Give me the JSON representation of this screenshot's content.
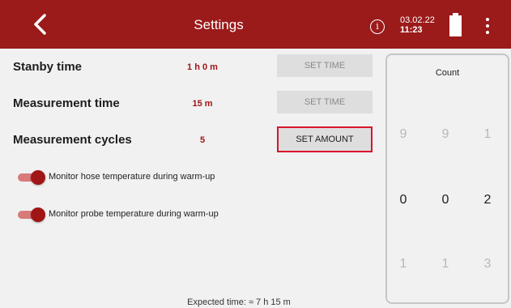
{
  "header": {
    "title": "Settings",
    "info_glyph": "i",
    "date": "03.02.22",
    "time": "11:23",
    "back_icon": "chevron-left-icon",
    "battery_icon": "battery-full-icon",
    "menu_icon": "more-vertical-icon",
    "color": "#9b1a1a"
  },
  "settings": {
    "rows": [
      {
        "label": "Stanby time",
        "value": "1 h 0 m",
        "button": "SET TIME",
        "active": false
      },
      {
        "label": "Measurement time",
        "value": "15 m",
        "button": "SET TIME",
        "active": false
      },
      {
        "label": "Measurement cycles",
        "value": "5",
        "button": "SET AMOUNT",
        "active": true
      }
    ],
    "toggles": [
      {
        "label": "Monitor hose temperature during warm-up",
        "on": true
      },
      {
        "label": "Monitor probe temperature during warm-up",
        "on": true
      }
    ],
    "expected_time": "Expected time: ≈ 7 h 15 m",
    "accent_color": "#a01515",
    "highlight_color": "#d8152b"
  },
  "count_panel": {
    "title": "Count",
    "columns": [
      {
        "above": "9",
        "current": "0",
        "below": "1"
      },
      {
        "above": "9",
        "current": "0",
        "below": "1"
      },
      {
        "above": "1",
        "current": "2",
        "below": "3"
      }
    ]
  }
}
